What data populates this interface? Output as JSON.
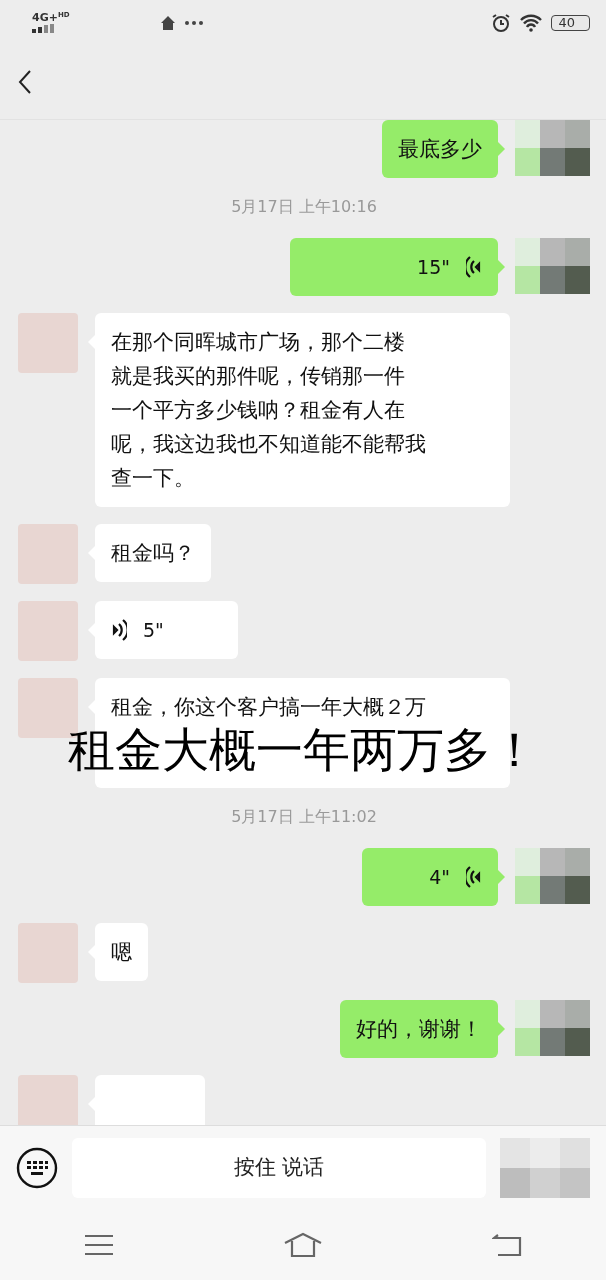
{
  "status_bar": {
    "network": "4G+",
    "network_sub": "HD",
    "battery": "40"
  },
  "messages": [
    {
      "kind": "text",
      "outgoing": true,
      "lines": [
        "最底多少"
      ]
    },
    {
      "kind": "time",
      "text": "5月17日 上午10:16"
    },
    {
      "kind": "voice",
      "outgoing": true,
      "duration": "15\""
    },
    {
      "kind": "text",
      "outgoing": false,
      "lines": [
        "在那个同晖城市广场，那个二楼",
        "就是我买的那件呢，传销那一件",
        "一个平方多少钱呐？租金有人在",
        "呢，我这边我也不知道能不能帮我",
        "查一下。"
      ]
    },
    {
      "kind": "text",
      "outgoing": false,
      "lines": [
        "租金吗？"
      ]
    },
    {
      "kind": "voice",
      "outgoing": false,
      "duration": "5\""
    },
    {
      "kind": "text",
      "outgoing": false,
      "lines": [
        "租金，你这个客户搞一年大概２万"
      ],
      "covered": true
    },
    {
      "kind": "time",
      "text": "5月17日 上午11:02"
    },
    {
      "kind": "voice",
      "outgoing": true,
      "duration": "4\""
    },
    {
      "kind": "text",
      "outgoing": false,
      "lines": [
        "嗯"
      ]
    },
    {
      "kind": "text",
      "outgoing": true,
      "lines": [
        "好的，谢谢！"
      ]
    },
    {
      "kind": "text",
      "outgoing": false
    }
  ],
  "caption": "租金大概一年两万多！",
  "input_bar": {
    "talk_button": "按住 说话"
  }
}
